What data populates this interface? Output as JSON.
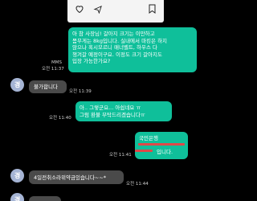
{
  "top_card": {
    "icons": [
      "heart-icon",
      "share-icon",
      "bookmark-icon"
    ]
  },
  "messages": [
    {
      "id": "m1",
      "direction": "out",
      "lines": [
        "아 참 사장님! 갈아지 크기는 이만하고",
        "몸무게는 8kg입니다. 실내에서 마킹은 하지",
        "않으나 혹시모르니 매너벨트, 하우스 다",
        "챙겨갈 예정이구요. 이정도 크기 갈아지도",
        "입장 가능한가요?"
      ],
      "tag": "MMS",
      "time": "오전 11:37"
    },
    {
      "id": "m2",
      "direction": "in",
      "avatar": "경",
      "text": "불가합니다",
      "time": "오전 11:39"
    },
    {
      "id": "m3",
      "direction": "out",
      "lines": [
        "아.. 그렇군요... 아쉽네요 ㅠ",
        "그럼 환불 부탁드리겠습니다ㅠ"
      ],
      "time": "오전 11:40"
    },
    {
      "id": "m4",
      "direction": "out",
      "lines": [
        "국민은행",
        "입니다."
      ],
      "time": "오전 11:41"
    },
    {
      "id": "m5",
      "direction": "in",
      "avatar": "경",
      "text": "4일전취소라위약금있습니다~~*",
      "time": "오전 11:44"
    },
    {
      "id": "m6",
      "direction": "in",
      "avatar": "경",
      "text": "",
      "time": ""
    }
  ]
}
